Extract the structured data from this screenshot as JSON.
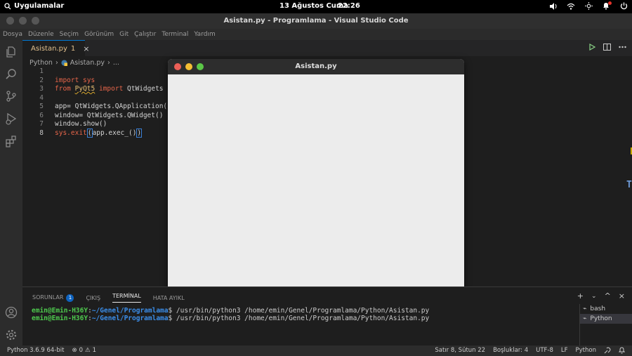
{
  "system_bar": {
    "apps_label": "Uygulamalar",
    "date": "13 Ağustos Cuma",
    "time": "22:26",
    "tray_icons": [
      "volume-icon",
      "wifi-icon",
      "brightness-icon",
      "notification-icon",
      "power-icon"
    ]
  },
  "window": {
    "title": "Asistan.py - Programlama - Visual Studio Code"
  },
  "menu": [
    "Dosya",
    "Düzenle",
    "Seçim",
    "Görünüm",
    "Git",
    "Çalıştır",
    "Terminal",
    "Yardım"
  ],
  "activity_bar": {
    "top_icons": [
      "explorer-icon",
      "search-icon",
      "source-control-icon",
      "run-debug-icon",
      "extensions-icon"
    ],
    "bottom_icons": [
      "account-icon",
      "settings-gear-icon"
    ]
  },
  "editor_tab": {
    "label": "Asistan.py",
    "problems": "1",
    "close": "×"
  },
  "breadcrumb": {
    "folder": "Python",
    "file": "Asistan.py",
    "more": "..."
  },
  "code": {
    "line_numbers": [
      "1",
      "2",
      "3",
      "4",
      "5",
      "6",
      "7",
      "8"
    ],
    "lines": [
      {
        "t": ""
      },
      {
        "kw1": "import",
        "rest": " sys"
      },
      {
        "kw1": "from",
        "mod": "PyQt5",
        "kw2": "import",
        "rest": "QtWidgets"
      },
      {
        "t": ""
      },
      {
        "t": "app= QtWidgets.QApplication(s"
      },
      {
        "t": "window= QtWidgets.QWidget()"
      },
      {
        "t": "window.show()"
      },
      {
        "a": "sys.exit",
        "b": "(",
        "c": "app.exec_()",
        "d": ")"
      }
    ]
  },
  "qt_window": {
    "title": "Asistan.py",
    "colors": {
      "close": "#ec5f57",
      "minimize": "#f5be33",
      "maximize": "#5bc747"
    }
  },
  "panel": {
    "tabs": [
      "SORUNLAR",
      "ÇIKIŞ",
      "TERMİNAL",
      "HATA AYIKL"
    ],
    "problems_count": "1",
    "terminal_lines": [
      {
        "user": "emin@Emin-H36Y",
        "sep": ":",
        "path": "~/Genel/Programlama",
        "cmd": "$ /usr/bin/python3 /home/emin/Genel/Programlama/Python/Asistan.py"
      },
      {
        "user": "emin@Emin-H36Y",
        "sep": ":",
        "path": "~/Genel/Programlama",
        "cmd": "$ /usr/bin/python3 /home/emin/Genel/Programlama/Python/Asistan.py"
      }
    ],
    "terminals": [
      "bash",
      "Python"
    ],
    "actions": {
      "add": "+",
      "chevron": "⌄",
      "maximize": "^",
      "close": "×"
    }
  },
  "status_bar": {
    "interpreter": "Python 3.6.9 64-bit",
    "errors": "0",
    "warnings": "1",
    "position": "Satır 8, Sütun 22",
    "indent": "Boşluklar: 4",
    "encoding": "UTF-8",
    "eol": "LF",
    "language": "Python"
  }
}
